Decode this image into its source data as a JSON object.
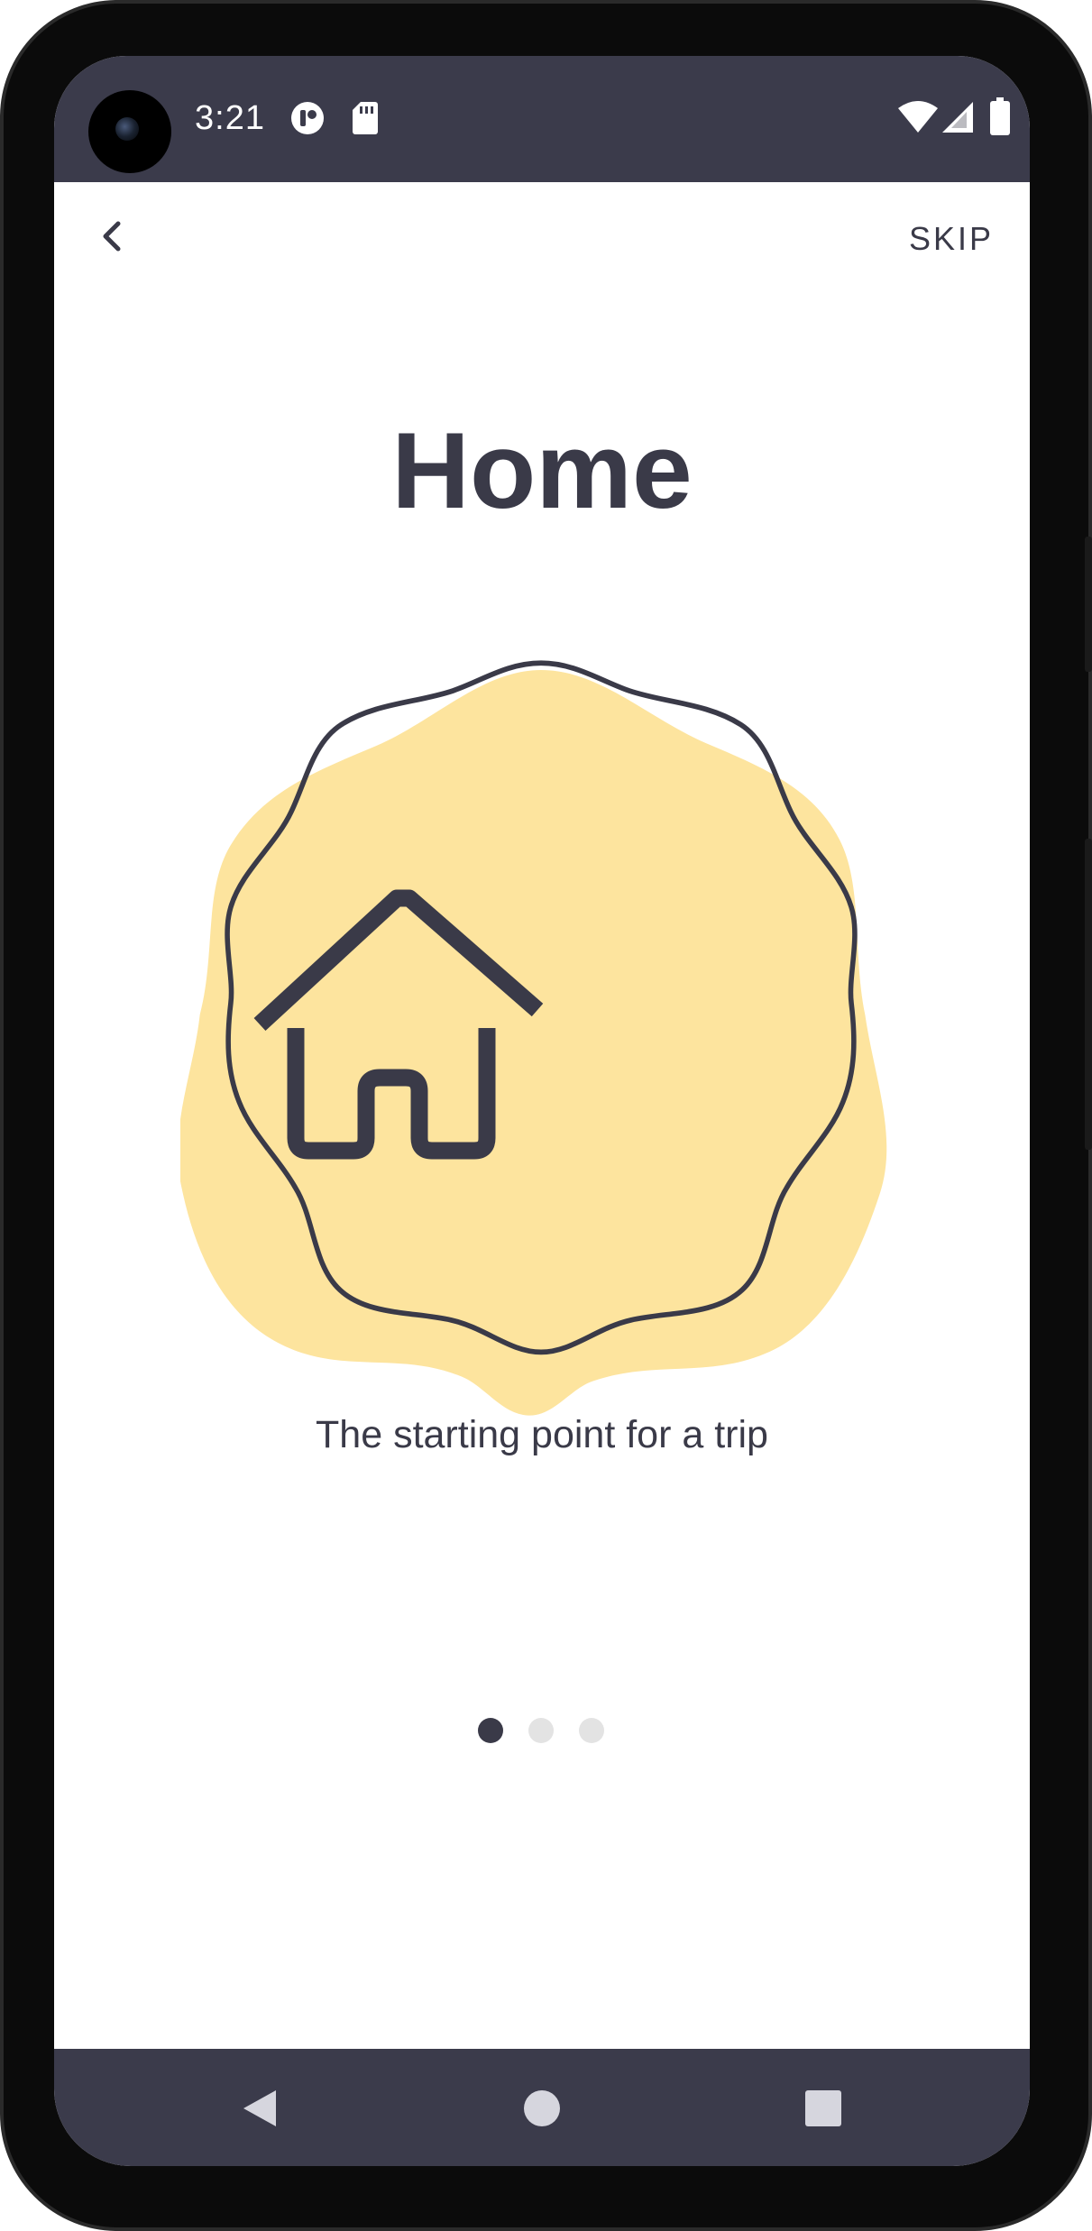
{
  "status_bar": {
    "time": "3:21",
    "icons": [
      "camera-icon",
      "notification-app-icon",
      "sd-card-icon",
      "wifi-icon",
      "cell-signal-icon",
      "battery-icon"
    ]
  },
  "header": {
    "back_icon": "chevron-left-icon",
    "skip_label": "SKIP"
  },
  "onboarding": {
    "title": "Home",
    "illustration_icon": "house-icon",
    "subtitle": "The starting point for a trip",
    "page_indicator": {
      "total": 3,
      "current": 1
    }
  },
  "nav_bar": {
    "buttons": [
      "back-triangle-icon",
      "home-circle-icon",
      "recents-square-icon"
    ]
  },
  "colors": {
    "bars": "#3b3b4b",
    "text": "#3a3a48",
    "badge_fill": "#fde49e",
    "dot_active": "#3a3a48",
    "dot_inactive": "#e3e3e3"
  }
}
